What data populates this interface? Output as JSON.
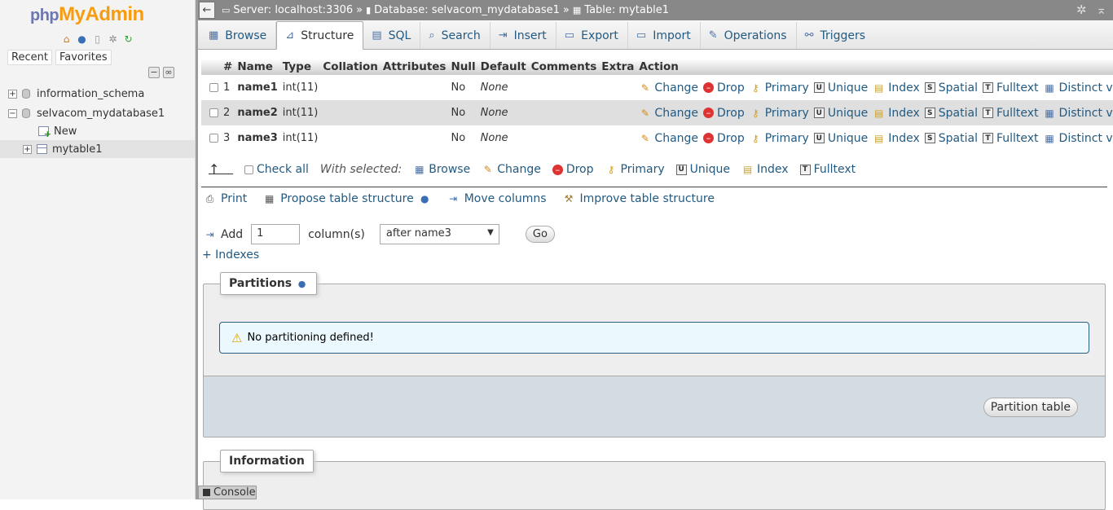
{
  "logo": {
    "php": "php",
    "myadmin": "MyAdmin"
  },
  "nav": {
    "icons": [
      "home-icon",
      "info-icon",
      "docs-icon",
      "settings-icon",
      "reload-icon"
    ],
    "tabs": [
      "Recent",
      "Favorites"
    ],
    "tree": {
      "db1": "information_schema",
      "db2": "selvacom_mydatabase1",
      "new_item": "New",
      "table1": "mytable1"
    }
  },
  "breadcrumb": {
    "server": "Server: localhost:3306",
    "database": "Database: selvacom_mydatabase1",
    "table": "Table: mytable1",
    "sep": "»"
  },
  "tabs": [
    {
      "label": "Browse",
      "icon": "browse-icon"
    },
    {
      "label": "Structure",
      "icon": "structure-icon",
      "active": true
    },
    {
      "label": "SQL",
      "icon": "sql-icon"
    },
    {
      "label": "Search",
      "icon": "search-icon"
    },
    {
      "label": "Insert",
      "icon": "insert-icon"
    },
    {
      "label": "Export",
      "icon": "export-icon"
    },
    {
      "label": "Import",
      "icon": "import-icon"
    },
    {
      "label": "Operations",
      "icon": "operations-icon"
    },
    {
      "label": "Triggers",
      "icon": "triggers-icon"
    }
  ],
  "table": {
    "headers": [
      "#",
      "Name",
      "Type",
      "Collation",
      "Attributes",
      "Null",
      "Default",
      "Comments",
      "Extra",
      "Action"
    ],
    "rows": [
      {
        "num": "1",
        "name": "name1",
        "type": "int(11)",
        "collation": "",
        "attributes": "",
        "null": "No",
        "default": "None",
        "comments": "",
        "extra": ""
      },
      {
        "num": "2",
        "name": "name2",
        "type": "int(11)",
        "collation": "",
        "attributes": "",
        "null": "No",
        "default": "None",
        "comments": "",
        "extra": ""
      },
      {
        "num": "3",
        "name": "name3",
        "type": "int(11)",
        "collation": "",
        "attributes": "",
        "null": "No",
        "default": "None",
        "comments": "",
        "extra": ""
      }
    ],
    "actions": [
      "Change",
      "Drop",
      "Primary",
      "Unique",
      "Index",
      "Spatial",
      "Fulltext",
      "Distinct values"
    ]
  },
  "with_selected": {
    "check_all": "Check all",
    "label": "With selected:",
    "actions": [
      "Browse",
      "Change",
      "Drop",
      "Primary",
      "Unique",
      "Index",
      "Fulltext"
    ]
  },
  "tools": {
    "print": "Print",
    "propose": "Propose table structure",
    "move": "Move columns",
    "improve": "Improve table structure"
  },
  "add_columns": {
    "label": "Add",
    "value": "1",
    "suffix": "column(s)",
    "position": "after name3",
    "go": "Go"
  },
  "indexes_link": "+ Indexes",
  "partitions": {
    "legend": "Partitions",
    "notice": "No partitioning defined!",
    "button": "Partition table"
  },
  "information": {
    "legend": "Information"
  },
  "console": "Console"
}
